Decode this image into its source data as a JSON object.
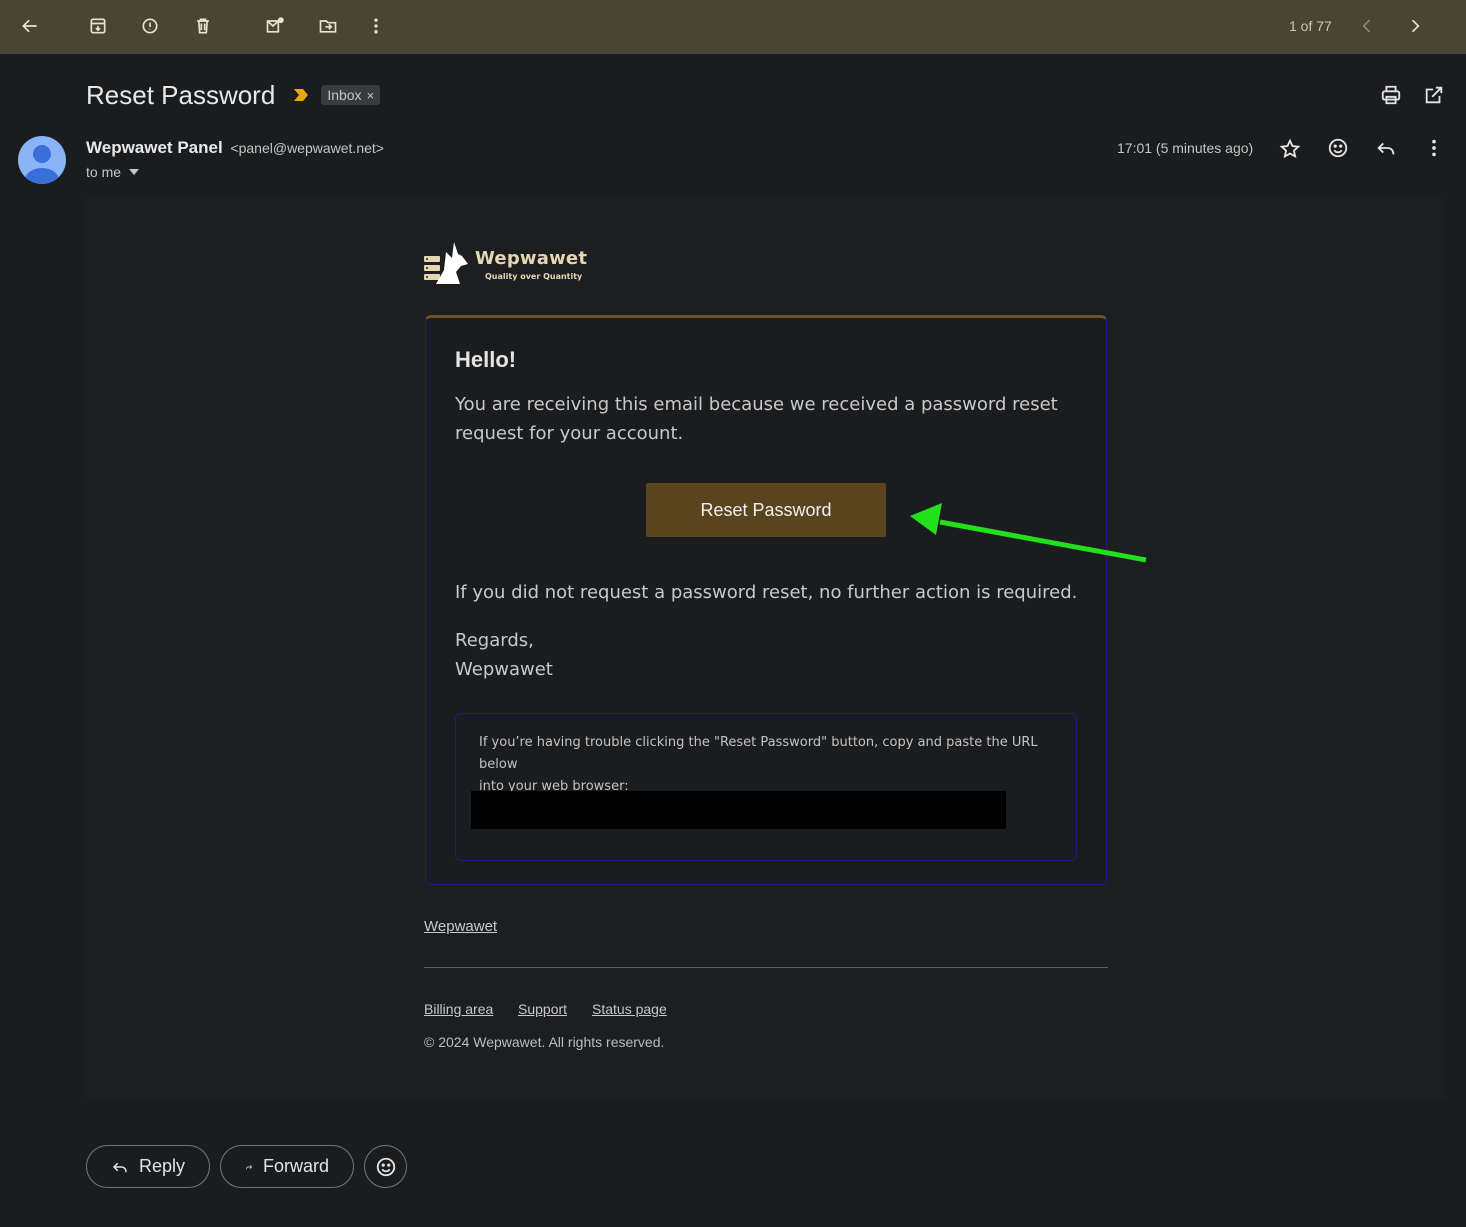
{
  "toolbar": {
    "pager": "1 of 77",
    "icons": [
      "back-icon",
      "archive-icon",
      "report-spam-icon",
      "delete-icon",
      "mark-unread-icon",
      "move-to-icon",
      "more-icon",
      "prev-icon",
      "next-icon"
    ]
  },
  "message": {
    "subject": "Reset Password",
    "label": "Inbox",
    "label_remove": "×",
    "sender_name": "Wepwawet Panel",
    "sender_email": "<panel@wepwawet.net>",
    "recipient": "to me",
    "timestamp": "17:01 (5 minutes ago)"
  },
  "email": {
    "logo_name": "Wepwawet",
    "logo_tagline": "Quality over Quantity",
    "greeting": "Hello!",
    "intro_line1": "You are receiving this email because we received a password reset",
    "intro_line2": "request for your account.",
    "button_label": "Reset Password",
    "outro": "If you did not request a password reset, no further action is required.",
    "regards": "Regards,",
    "signature": "Wepwawet",
    "subcopy_line1": "If you’re having trouble clicking the \"Reset Password\" button, copy and paste the URL below",
    "subcopy_line2": "into your web browser:",
    "footer_brand_link": "Wepwawet",
    "footer_links": [
      "Billing area",
      "Support",
      "Status page"
    ],
    "copyright": "© 2024 Wepwawet. All rights reserved."
  },
  "actions": {
    "reply": "Reply",
    "forward": "Forward"
  },
  "colors": {
    "topbar": "#4a4533",
    "button_bg": "#5a4420",
    "card_border": "#1f1e7a",
    "annotation_arrow": "#22e01c",
    "importance": "#e8a812"
  }
}
